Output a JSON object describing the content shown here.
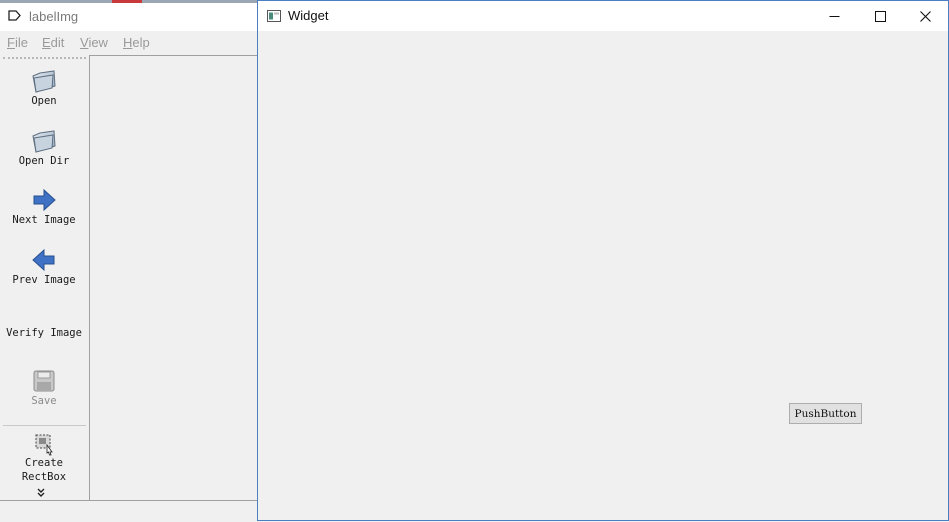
{
  "background_app": {
    "title": "labelImg",
    "menu": [
      {
        "label": "File"
      },
      {
        "label": "Edit"
      },
      {
        "label": "View"
      },
      {
        "label": "Help"
      }
    ],
    "toolbar": {
      "open": {
        "label": "Open",
        "icon": "folder-open-icon"
      },
      "open_dir": {
        "label": "Open Dir",
        "icon": "folder-open-icon"
      },
      "next_image": {
        "label": "Next Image",
        "icon": "arrow-right-icon"
      },
      "prev_image": {
        "label": "Prev Image",
        "icon": "arrow-left-icon"
      },
      "verify_image": {
        "label": "Verify Image"
      },
      "save": {
        "label": "Save",
        "icon": "floppy-disk-icon",
        "enabled": false
      },
      "create_rectbox": {
        "label_line1": "Create",
        "label_line2": "RectBox",
        "icon": "draw-rect-icon"
      },
      "more": {
        "label": "»",
        "icon": "chevron-double-down-icon"
      }
    }
  },
  "widget_window": {
    "title": "Widget",
    "minimize_icon": "minimize-icon",
    "maximize_icon": "maximize-icon",
    "close_icon": "close-icon",
    "push_button_label": "PushButton"
  },
  "colors": {
    "accent_border": "#4a7fc1",
    "window_bg": "#f0f0f0",
    "titlebar_bg": "#ffffff",
    "arrow_blue": "#3f72c4"
  }
}
